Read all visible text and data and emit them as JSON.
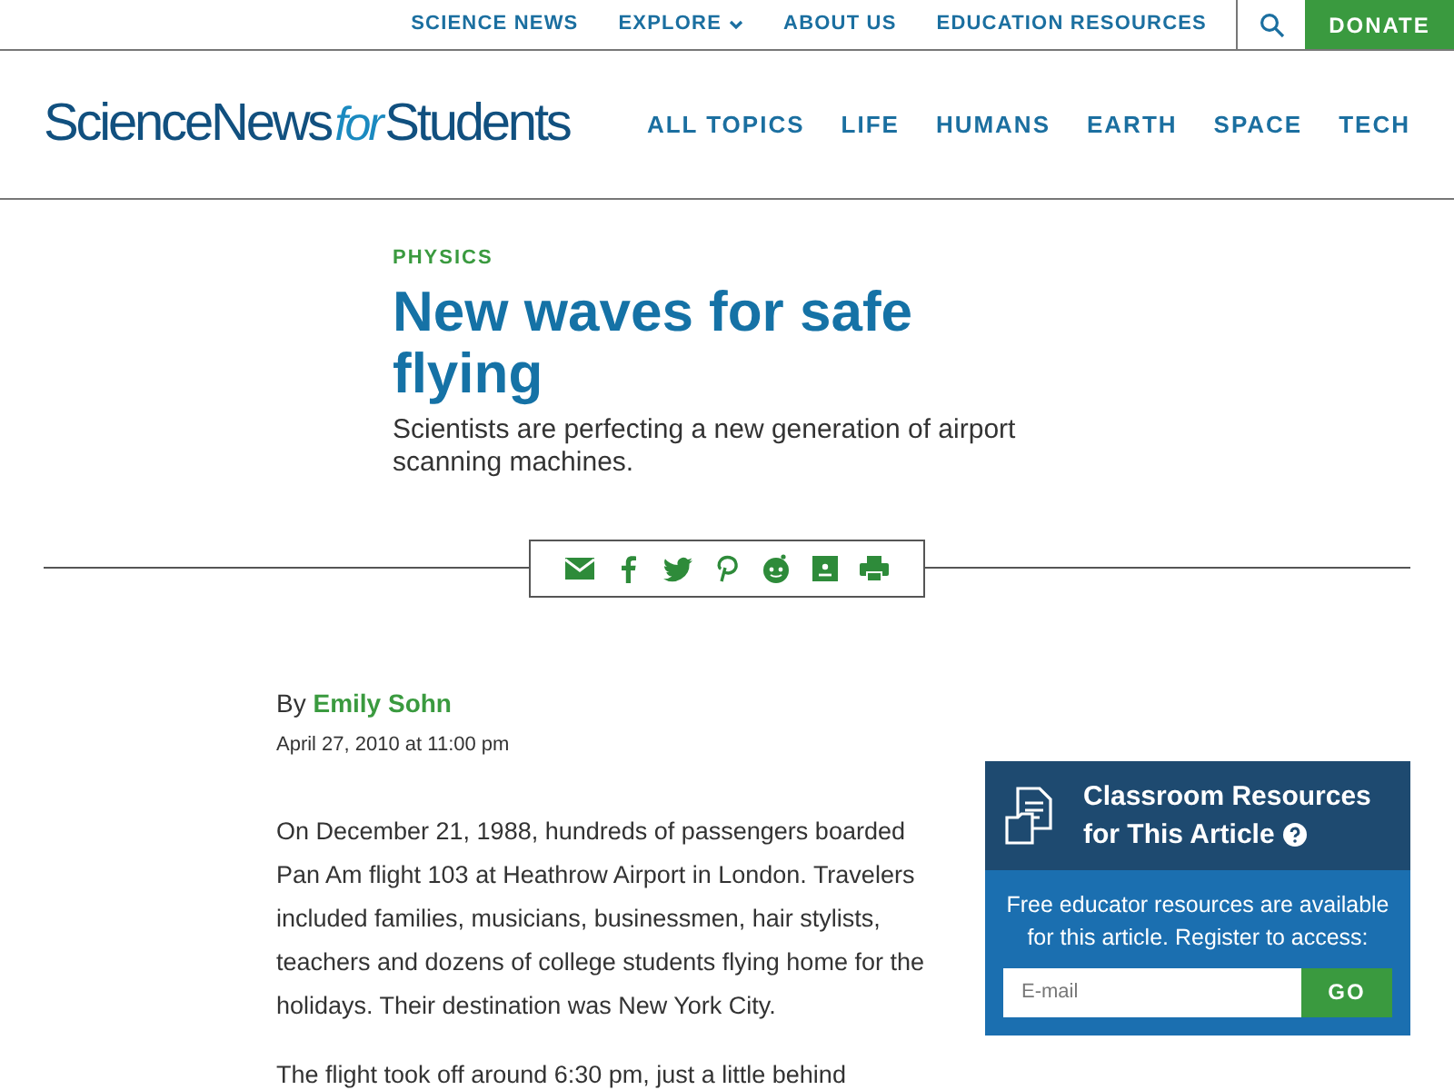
{
  "top_nav": {
    "links": [
      {
        "label": "SCIENCE NEWS",
        "kind": "link"
      },
      {
        "label": "EXPLORE",
        "kind": "dropdown"
      },
      {
        "label": "ABOUT US",
        "kind": "link"
      },
      {
        "label": "EDUCATION RESOURCES",
        "kind": "link"
      }
    ],
    "donate": "DONATE"
  },
  "header": {
    "logo": [
      {
        "text": "ScienceNews",
        "italic": false
      },
      {
        "text": "for",
        "italic": true
      },
      {
        "text": "Students",
        "italic": false
      }
    ],
    "sections": [
      "ALL TOPICS",
      "LIFE",
      "HUMANS",
      "EARTH",
      "SPACE",
      "TECH"
    ]
  },
  "article": {
    "category": "PHYSICS",
    "title": "New waves for safe flying",
    "subtitle": "Scientists are perfecting a new generation of airport scanning machines.",
    "byline_prefix": "By",
    "author": "Emily Sohn",
    "date": "April 27, 2010 at 11:00 pm",
    "paragraphs": [
      "On December 21, 1988, hundreds of passengers boarded Pan Am flight 103 at Heathrow Airport in London. Travelers included families, musicians, businessmen, hair stylists, teachers and dozens of college students flying home for the holidays. Their destination was New York City.",
      "The flight took off around 6:30 pm, just a little behind"
    ]
  },
  "sidebar": {
    "title_lines": [
      "Classroom Resources",
      "for This Article"
    ],
    "text": "Free educator resources are available for this article. Register to access:",
    "email": {
      "placeholder": "E-mail"
    },
    "button": "GO"
  }
}
